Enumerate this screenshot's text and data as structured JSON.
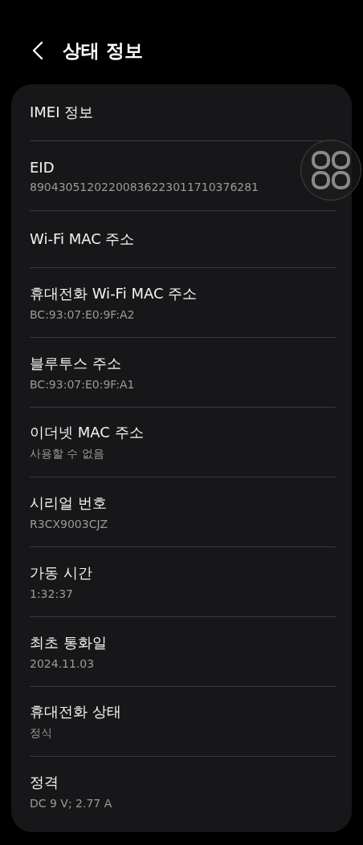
{
  "header": {
    "title": "상태 정보"
  },
  "items": [
    {
      "label": "IMEI 정보"
    },
    {
      "label": "EID",
      "value": "89043051202200836223011710376281"
    },
    {
      "label": "Wi-Fi MAC 주소"
    },
    {
      "label": "휴대전화 Wi-Fi MAC 주소",
      "value": "BC:93:07:E0:9F:A2"
    },
    {
      "label": "블루투스 주소",
      "value": "BC:93:07:E0:9F:A1"
    },
    {
      "label": "이더넷 MAC 주소",
      "value": "사용할 수 없음"
    },
    {
      "label": "시리얼 번호",
      "value": "R3CX9003CJZ"
    },
    {
      "label": "가동 시간",
      "value": "1:32:37"
    },
    {
      "label": "최초 통화일",
      "value": "2024.11.03"
    },
    {
      "label": "휴대전화 상태",
      "value": "정식"
    },
    {
      "label": "정격",
      "value": "DC 9 V; 2.77 A"
    }
  ]
}
